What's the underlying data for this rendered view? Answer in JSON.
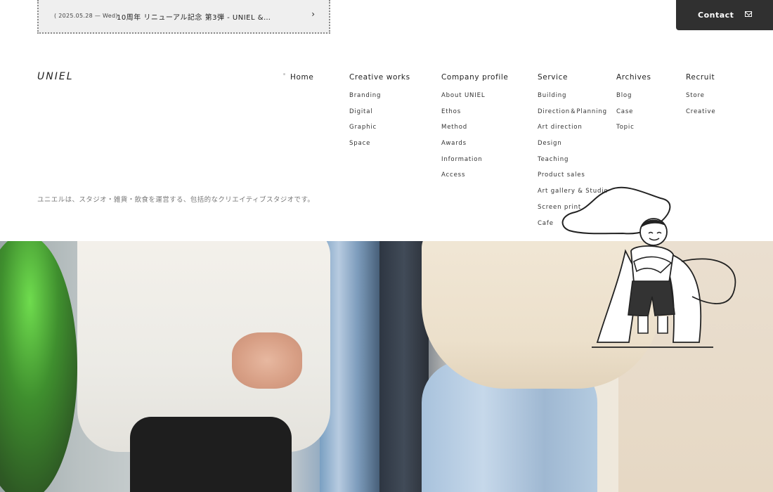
{
  "news": {
    "date": "( 2025.05.28 — Wed)",
    "title": "10周年 リニューアル記念 第3弾 - UNIEL &…",
    "arrow": "›"
  },
  "contact": {
    "label": "Contact",
    "icon": "mail-icon"
  },
  "logo": "UNIEL",
  "nav": {
    "home": "Home",
    "creative_works": {
      "label": "Creative works",
      "items": [
        "Branding",
        "Digital",
        "Graphic",
        "Space"
      ]
    },
    "company_profile": {
      "label": "Company profile",
      "items": [
        "About UNIEL",
        "Ethos",
        "Method",
        "Awards",
        "Information",
        "Access"
      ]
    },
    "service": {
      "label": "Service",
      "items": [
        "Building",
        "Direction＆Planning",
        "Art direction",
        "Design",
        "Teaching",
        "Product sales",
        "Art gallery & Studio",
        "Screen print",
        "Cafe"
      ]
    },
    "archives": {
      "label": "Archives",
      "items": [
        "Blog",
        "Case",
        "Topic"
      ]
    },
    "recruit": {
      "label": "Recruit",
      "items": [
        "Store",
        "Creative"
      ]
    }
  },
  "tagline": "ユニエルは、スタジオ・雑貨・飲食を運営する、包括的なクリエイティブスタジオです。",
  "colors": {
    "contact_bg": "#303030",
    "news_bg": "#efefef",
    "text": "#222222",
    "muted": "#777777"
  }
}
